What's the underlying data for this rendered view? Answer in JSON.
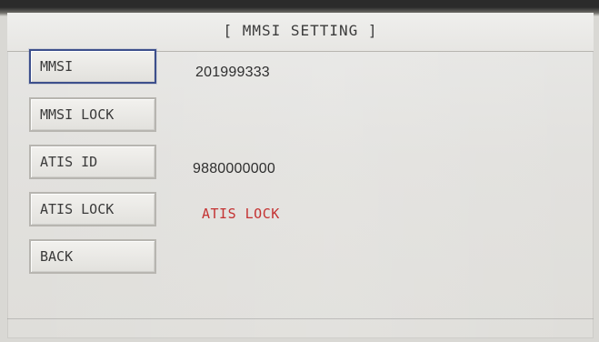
{
  "header": {
    "title": "[ MMSI SETTING ]"
  },
  "menu": {
    "mmsi_label": "MMSI",
    "mmsi_lock_label": "MMSI LOCK",
    "atis_id_label": "ATIS ID",
    "atis_lock_label": "ATIS LOCK",
    "back_label": "BACK"
  },
  "values": {
    "mmsi": "201999333",
    "atis_id": "9880000000",
    "atis_lock_status": "ATIS LOCK"
  },
  "colors": {
    "selected_border": "#3D4F8C",
    "warning_text": "#C43232"
  }
}
